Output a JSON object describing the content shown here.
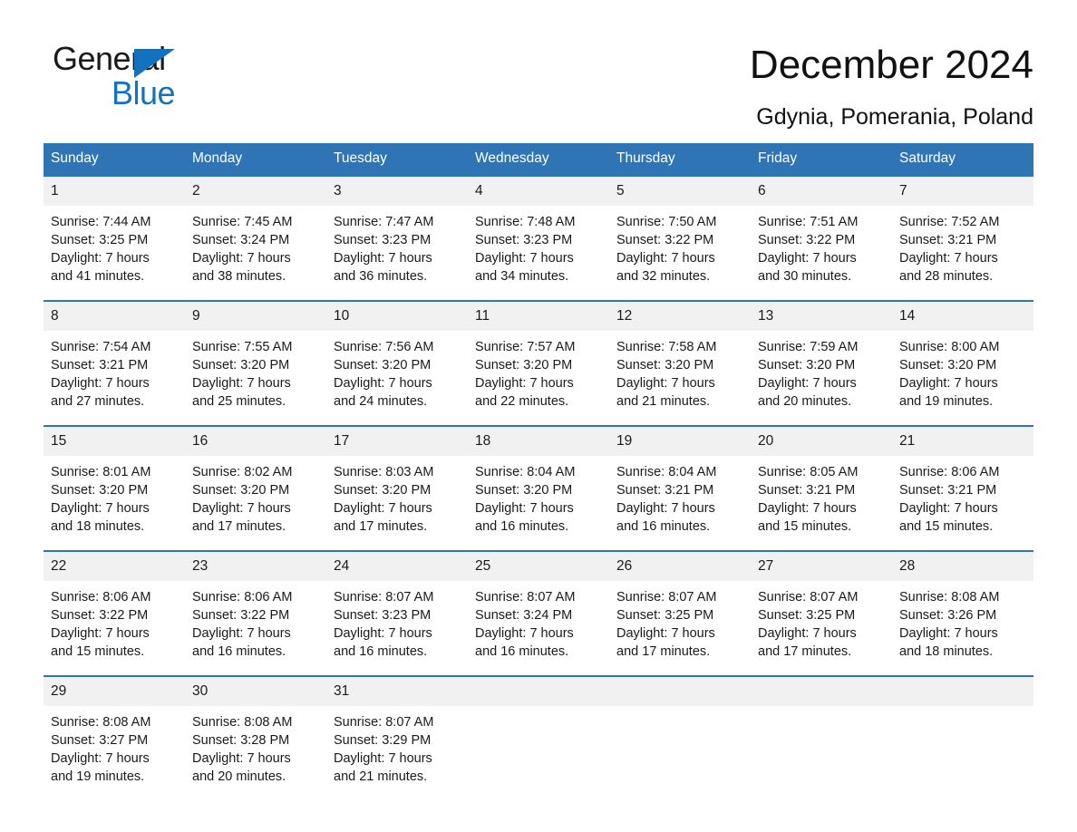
{
  "brand": {
    "name_part1": "General",
    "name_part2": "Blue",
    "triangle_color": "#1471bd",
    "icon": "triangle-icon"
  },
  "header": {
    "month_title": "December 2024",
    "location": "Gdynia, Pomerania, Poland"
  },
  "theme": {
    "header_blue": "#2f74b5",
    "daynum_gray": "#f1f1f1",
    "text": "#1a1a1a"
  },
  "calendar": {
    "weekday_headers": [
      "Sunday",
      "Monday",
      "Tuesday",
      "Wednesday",
      "Thursday",
      "Friday",
      "Saturday"
    ],
    "weeks": [
      [
        {
          "day": "1",
          "sunrise": "Sunrise: 7:44 AM",
          "sunset": "Sunset: 3:25 PM",
          "daylight_line1": "Daylight: 7 hours",
          "daylight_line2": "and 41 minutes."
        },
        {
          "day": "2",
          "sunrise": "Sunrise: 7:45 AM",
          "sunset": "Sunset: 3:24 PM",
          "daylight_line1": "Daylight: 7 hours",
          "daylight_line2": "and 38 minutes."
        },
        {
          "day": "3",
          "sunrise": "Sunrise: 7:47 AM",
          "sunset": "Sunset: 3:23 PM",
          "daylight_line1": "Daylight: 7 hours",
          "daylight_line2": "and 36 minutes."
        },
        {
          "day": "4",
          "sunrise": "Sunrise: 7:48 AM",
          "sunset": "Sunset: 3:23 PM",
          "daylight_line1": "Daylight: 7 hours",
          "daylight_line2": "and 34 minutes."
        },
        {
          "day": "5",
          "sunrise": "Sunrise: 7:50 AM",
          "sunset": "Sunset: 3:22 PM",
          "daylight_line1": "Daylight: 7 hours",
          "daylight_line2": "and 32 minutes."
        },
        {
          "day": "6",
          "sunrise": "Sunrise: 7:51 AM",
          "sunset": "Sunset: 3:22 PM",
          "daylight_line1": "Daylight: 7 hours",
          "daylight_line2": "and 30 minutes."
        },
        {
          "day": "7",
          "sunrise": "Sunrise: 7:52 AM",
          "sunset": "Sunset: 3:21 PM",
          "daylight_line1": "Daylight: 7 hours",
          "daylight_line2": "and 28 minutes."
        }
      ],
      [
        {
          "day": "8",
          "sunrise": "Sunrise: 7:54 AM",
          "sunset": "Sunset: 3:21 PM",
          "daylight_line1": "Daylight: 7 hours",
          "daylight_line2": "and 27 minutes."
        },
        {
          "day": "9",
          "sunrise": "Sunrise: 7:55 AM",
          "sunset": "Sunset: 3:20 PM",
          "daylight_line1": "Daylight: 7 hours",
          "daylight_line2": "and 25 minutes."
        },
        {
          "day": "10",
          "sunrise": "Sunrise: 7:56 AM",
          "sunset": "Sunset: 3:20 PM",
          "daylight_line1": "Daylight: 7 hours",
          "daylight_line2": "and 24 minutes."
        },
        {
          "day": "11",
          "sunrise": "Sunrise: 7:57 AM",
          "sunset": "Sunset: 3:20 PM",
          "daylight_line1": "Daylight: 7 hours",
          "daylight_line2": "and 22 minutes."
        },
        {
          "day": "12",
          "sunrise": "Sunrise: 7:58 AM",
          "sunset": "Sunset: 3:20 PM",
          "daylight_line1": "Daylight: 7 hours",
          "daylight_line2": "and 21 minutes."
        },
        {
          "day": "13",
          "sunrise": "Sunrise: 7:59 AM",
          "sunset": "Sunset: 3:20 PM",
          "daylight_line1": "Daylight: 7 hours",
          "daylight_line2": "and 20 minutes."
        },
        {
          "day": "14",
          "sunrise": "Sunrise: 8:00 AM",
          "sunset": "Sunset: 3:20 PM",
          "daylight_line1": "Daylight: 7 hours",
          "daylight_line2": "and 19 minutes."
        }
      ],
      [
        {
          "day": "15",
          "sunrise": "Sunrise: 8:01 AM",
          "sunset": "Sunset: 3:20 PM",
          "daylight_line1": "Daylight: 7 hours",
          "daylight_line2": "and 18 minutes."
        },
        {
          "day": "16",
          "sunrise": "Sunrise: 8:02 AM",
          "sunset": "Sunset: 3:20 PM",
          "daylight_line1": "Daylight: 7 hours",
          "daylight_line2": "and 17 minutes."
        },
        {
          "day": "17",
          "sunrise": "Sunrise: 8:03 AM",
          "sunset": "Sunset: 3:20 PM",
          "daylight_line1": "Daylight: 7 hours",
          "daylight_line2": "and 17 minutes."
        },
        {
          "day": "18",
          "sunrise": "Sunrise: 8:04 AM",
          "sunset": "Sunset: 3:20 PM",
          "daylight_line1": "Daylight: 7 hours",
          "daylight_line2": "and 16 minutes."
        },
        {
          "day": "19",
          "sunrise": "Sunrise: 8:04 AM",
          "sunset": "Sunset: 3:21 PM",
          "daylight_line1": "Daylight: 7 hours",
          "daylight_line2": "and 16 minutes."
        },
        {
          "day": "20",
          "sunrise": "Sunrise: 8:05 AM",
          "sunset": "Sunset: 3:21 PM",
          "daylight_line1": "Daylight: 7 hours",
          "daylight_line2": "and 15 minutes."
        },
        {
          "day": "21",
          "sunrise": "Sunrise: 8:06 AM",
          "sunset": "Sunset: 3:21 PM",
          "daylight_line1": "Daylight: 7 hours",
          "daylight_line2": "and 15 minutes."
        }
      ],
      [
        {
          "day": "22",
          "sunrise": "Sunrise: 8:06 AM",
          "sunset": "Sunset: 3:22 PM",
          "daylight_line1": "Daylight: 7 hours",
          "daylight_line2": "and 15 minutes."
        },
        {
          "day": "23",
          "sunrise": "Sunrise: 8:06 AM",
          "sunset": "Sunset: 3:22 PM",
          "daylight_line1": "Daylight: 7 hours",
          "daylight_line2": "and 16 minutes."
        },
        {
          "day": "24",
          "sunrise": "Sunrise: 8:07 AM",
          "sunset": "Sunset: 3:23 PM",
          "daylight_line1": "Daylight: 7 hours",
          "daylight_line2": "and 16 minutes."
        },
        {
          "day": "25",
          "sunrise": "Sunrise: 8:07 AM",
          "sunset": "Sunset: 3:24 PM",
          "daylight_line1": "Daylight: 7 hours",
          "daylight_line2": "and 16 minutes."
        },
        {
          "day": "26",
          "sunrise": "Sunrise: 8:07 AM",
          "sunset": "Sunset: 3:25 PM",
          "daylight_line1": "Daylight: 7 hours",
          "daylight_line2": "and 17 minutes."
        },
        {
          "day": "27",
          "sunrise": "Sunrise: 8:07 AM",
          "sunset": "Sunset: 3:25 PM",
          "daylight_line1": "Daylight: 7 hours",
          "daylight_line2": "and 17 minutes."
        },
        {
          "day": "28",
          "sunrise": "Sunrise: 8:08 AM",
          "sunset": "Sunset: 3:26 PM",
          "daylight_line1": "Daylight: 7 hours",
          "daylight_line2": "and 18 minutes."
        }
      ],
      [
        {
          "day": "29",
          "sunrise": "Sunrise: 8:08 AM",
          "sunset": "Sunset: 3:27 PM",
          "daylight_line1": "Daylight: 7 hours",
          "daylight_line2": "and 19 minutes."
        },
        {
          "day": "30",
          "sunrise": "Sunrise: 8:08 AM",
          "sunset": "Sunset: 3:28 PM",
          "daylight_line1": "Daylight: 7 hours",
          "daylight_line2": "and 20 minutes."
        },
        {
          "day": "31",
          "sunrise": "Sunrise: 8:07 AM",
          "sunset": "Sunset: 3:29 PM",
          "daylight_line1": "Daylight: 7 hours",
          "daylight_line2": "and 21 minutes."
        },
        {
          "day": "",
          "sunrise": "",
          "sunset": "",
          "daylight_line1": "",
          "daylight_line2": ""
        },
        {
          "day": "",
          "sunrise": "",
          "sunset": "",
          "daylight_line1": "",
          "daylight_line2": ""
        },
        {
          "day": "",
          "sunrise": "",
          "sunset": "",
          "daylight_line1": "",
          "daylight_line2": ""
        },
        {
          "day": "",
          "sunrise": "",
          "sunset": "",
          "daylight_line1": "",
          "daylight_line2": ""
        }
      ]
    ]
  }
}
